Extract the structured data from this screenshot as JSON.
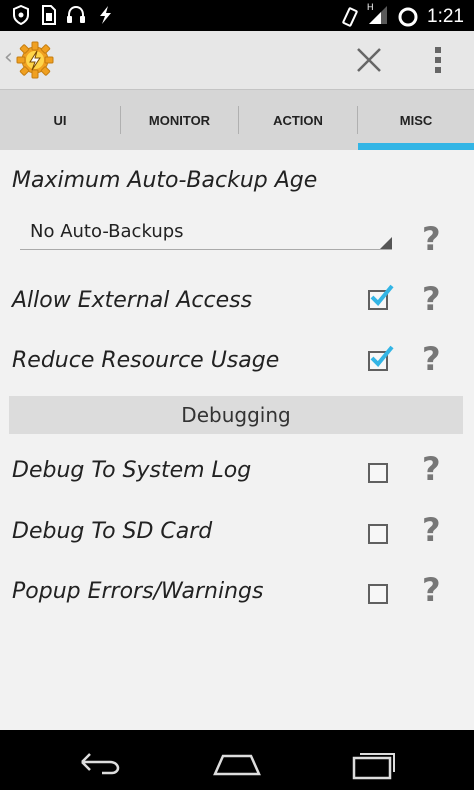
{
  "status_bar": {
    "time": "1:21",
    "left_icons": [
      "shield-icon",
      "sim-icon",
      "headphones-icon",
      "bolt-icon"
    ],
    "right_icons": [
      "vibrate-icon",
      "signal-icon",
      "alarm-icon"
    ],
    "signal_badge": "H"
  },
  "action_bar": {
    "icons": [
      "back-chevron-icon",
      "tasker-logo-icon",
      "close-icon",
      "overflow-menu-icon"
    ],
    "back_glyph": "‹"
  },
  "tabs": [
    {
      "label": "UI"
    },
    {
      "label": "MONITOR"
    },
    {
      "label": "ACTION"
    },
    {
      "label": "MISC",
      "selected": true
    }
  ],
  "settings": {
    "max_backup_age_label": "Maximum Auto-Backup Age",
    "max_backup_age_value": "No Auto-Backups",
    "allow_external_access_label": "Allow External Access",
    "allow_external_access_checked": true,
    "reduce_resource_usage_label": "Reduce Resource Usage",
    "reduce_resource_usage_checked": true,
    "debugging_section_title": "Debugging",
    "debug_system_log_label": "Debug To System Log",
    "debug_system_log_checked": false,
    "debug_sd_card_label": "Debug To SD Card",
    "debug_sd_card_checked": false,
    "popup_errors_label": "Popup Errors/Warnings",
    "popup_errors_checked": false,
    "help_glyph": "?"
  },
  "colors": {
    "accent": "#33b5e5",
    "logo": "#f0a020",
    "checkbox_tick": "#33b5e5"
  },
  "nav_bar": {
    "icons": [
      "nav-back-icon",
      "nav-home-icon",
      "nav-recents-icon"
    ]
  }
}
